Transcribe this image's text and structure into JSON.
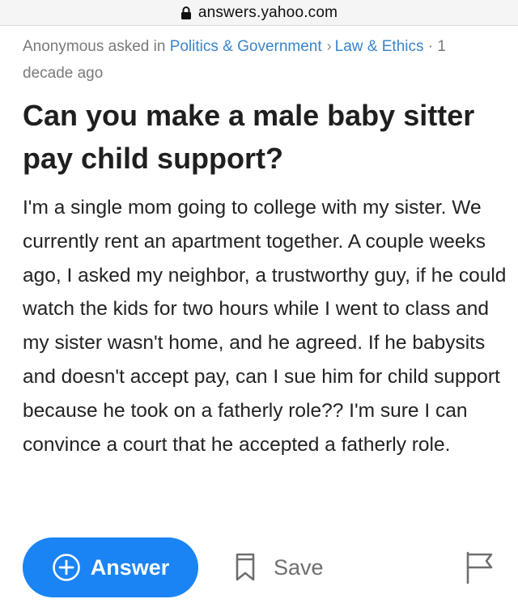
{
  "browser": {
    "url": "answers.yahoo.com",
    "icons": {
      "lock": "lock-icon"
    }
  },
  "question": {
    "asker": "Anonymous",
    "asked_in": "asked in",
    "category": "Politics & Government",
    "subcategory": "Law & Ethics",
    "age": "· 1 decade ago",
    "title": "Can you make a male baby sitter pay child support?",
    "body": "I'm a single mom going to college with my sister. We currently rent an apartment together. A couple weeks ago, I asked my neighbor, a trustworthy guy, if he could watch the kids for two hours while I went to class and my sister wasn't home, and he agreed. If he babysits and doesn't accept pay, can I sue him for child support because he took on a fatherly role?? I'm sure I can convince a court that he accepted a fatherly role."
  },
  "actions": {
    "answer_label": "Answer",
    "save_label": "Save",
    "icons": {
      "answer": "plus-circle-icon",
      "save": "bookmark-icon",
      "report": "flag-icon"
    }
  },
  "colors": {
    "link": "#3a84c8",
    "answer_button": "#1a84f5",
    "meta_text": "#7a7a7a"
  }
}
